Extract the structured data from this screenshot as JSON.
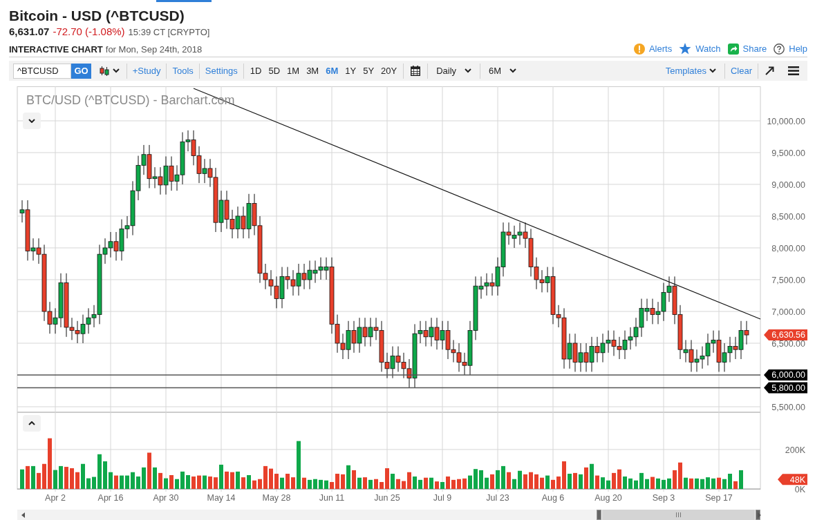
{
  "title": "Bitcoin - USD (^BTCUSD)",
  "quote": {
    "last": "6,631.07",
    "change": "-72.70 (-1.08%)",
    "negative": true,
    "time": "15:39 CT [CRYPTO]"
  },
  "subtitle": {
    "label": "INTERACTIVE CHART",
    "date": "for Mon, Sep 24th, 2018"
  },
  "actions": [
    {
      "kind": "alert",
      "label": "Alerts"
    },
    {
      "kind": "watch",
      "label": "Watch"
    },
    {
      "kind": "share",
      "label": "Share"
    },
    {
      "kind": "help",
      "label": "Help"
    }
  ],
  "toolbar": {
    "symbol": "^BTCUSD",
    "go": "GO",
    "tools": [
      "+Study",
      "Tools",
      "Settings"
    ],
    "ranges": [
      {
        "label": "1D",
        "selected": false
      },
      {
        "label": "5D",
        "selected": false
      },
      {
        "label": "1M",
        "selected": false
      },
      {
        "label": "3M",
        "selected": false
      },
      {
        "label": "6M",
        "selected": true
      },
      {
        "label": "1Y",
        "selected": false
      },
      {
        "label": "5Y",
        "selected": false
      },
      {
        "label": "20Y",
        "selected": false
      }
    ],
    "interval": "Daily",
    "period": "6M",
    "templates": "Templates",
    "clear": "Clear"
  },
  "chart": {
    "title": "BTC/USD (^BTCUSD) - Barchart.com",
    "price_pane": {
      "last_price": "6,630.56",
      "chart_data": {
        "type": "candlestick",
        "ylim": [
          5413,
          10543
        ],
        "categories": [
          null,
          null,
          null,
          null,
          null,
          null,
          null,
          null,
          null,
          null,
          null,
          null,
          null,
          null,
          null,
          null,
          null,
          null,
          null,
          null,
          null,
          null,
          null,
          null,
          null,
          null,
          null,
          null,
          null,
          null,
          null,
          null,
          null,
          null,
          null,
          null,
          null,
          null,
          null,
          null,
          null,
          null,
          null,
          null,
          null,
          null,
          null,
          null,
          null,
          null,
          null,
          null,
          null,
          null,
          null,
          null,
          null,
          null,
          null,
          null,
          null,
          null,
          null,
          null,
          null,
          null,
          null,
          null,
          null,
          null,
          null,
          null,
          null,
          null,
          null,
          null,
          null,
          null,
          null,
          null,
          null,
          null,
          null,
          null,
          null,
          null,
          null,
          null,
          null,
          null,
          null,
          null,
          null,
          null,
          null,
          null,
          null,
          null,
          null,
          null,
          null,
          null,
          null,
          null,
          null,
          null,
          null,
          null,
          null,
          null,
          null,
          null,
          null,
          null,
          null,
          null,
          null,
          null,
          null,
          null,
          null,
          null,
          null,
          null,
          null,
          null,
          null,
          null,
          null,
          null,
          null,
          null
        ],
        "grid": true,
        "ohlc": [
          [
            8550,
            8750,
            8400,
            8600
          ],
          [
            8600,
            8750,
            7800,
            7950
          ],
          [
            7950,
            8150,
            7800,
            8000
          ],
          [
            8000,
            8150,
            7750,
            7900
          ],
          [
            7900,
            8050,
            6850,
            7000
          ],
          [
            7000,
            7150,
            6650,
            6800
          ],
          [
            6800,
            7050,
            6650,
            6900
          ],
          [
            6900,
            7600,
            6750,
            7450
          ],
          [
            7450,
            7600,
            6600,
            6750
          ],
          [
            6750,
            6900,
            6550,
            6700
          ],
          [
            6700,
            6850,
            6500,
            6650
          ],
          [
            6650,
            6950,
            6500,
            6800
          ],
          [
            6800,
            7050,
            6650,
            6900
          ],
          [
            6900,
            7100,
            6750,
            6950
          ],
          [
            6950,
            8050,
            6800,
            7900
          ],
          [
            7900,
            8150,
            7750,
            8000
          ],
          [
            8000,
            8250,
            7850,
            8100
          ],
          [
            8100,
            8250,
            7800,
            7950
          ],
          [
            7950,
            8450,
            7800,
            8300
          ],
          [
            8300,
            8500,
            8150,
            8350
          ],
          [
            8350,
            9050,
            8200,
            8900
          ],
          [
            8900,
            9450,
            8750,
            9300
          ],
          [
            9300,
            9620,
            9150,
            9470
          ],
          [
            9470,
            9620,
            8940,
            9090
          ],
          [
            9090,
            9270,
            8940,
            9120
          ],
          [
            9120,
            9270,
            8840,
            8990
          ],
          [
            8990,
            9440,
            8840,
            9290
          ],
          [
            9290,
            9440,
            8900,
            9050
          ],
          [
            9050,
            9300,
            8900,
            9150
          ],
          [
            9150,
            9820,
            9000,
            9670
          ],
          [
            9670,
            9850,
            9520,
            9700
          ],
          [
            9700,
            9850,
            9300,
            9450
          ],
          [
            9450,
            9600,
            9020,
            9170
          ],
          [
            9170,
            9400,
            9020,
            9250
          ],
          [
            9250,
            9400,
            8960,
            9110
          ],
          [
            9110,
            9260,
            8250,
            8400
          ],
          [
            8400,
            8900,
            8250,
            8750
          ],
          [
            8750,
            8900,
            8300,
            8450
          ],
          [
            8450,
            8600,
            8150,
            8300
          ],
          [
            8300,
            8650,
            8150,
            8500
          ],
          [
            8500,
            8650,
            8150,
            8300
          ],
          [
            8300,
            8850,
            8150,
            8700
          ],
          [
            8700,
            8850,
            8200,
            8350
          ],
          [
            8350,
            8500,
            7450,
            7600
          ],
          [
            7600,
            7750,
            7350,
            7500
          ],
          [
            7500,
            7650,
            7250,
            7400
          ],
          [
            7400,
            7550,
            7050,
            7200
          ],
          [
            7200,
            7700,
            7050,
            7550
          ],
          [
            7550,
            7700,
            7350,
            7500
          ],
          [
            7500,
            7650,
            7250,
            7400
          ],
          [
            7400,
            7750,
            7250,
            7600
          ],
          [
            7600,
            7750,
            7350,
            7500
          ],
          [
            7500,
            7800,
            7350,
            7650
          ],
          [
            7600,
            7800,
            7450,
            7650
          ],
          [
            7650,
            7850,
            7500,
            7700
          ],
          [
            7650,
            7850,
            7500,
            7700
          ],
          [
            7700,
            7850,
            6650,
            6800
          ],
          [
            6800,
            6950,
            6350,
            6500
          ],
          [
            6500,
            6650,
            6250,
            6400
          ],
          [
            6400,
            6850,
            6250,
            6700
          ],
          [
            6700,
            6850,
            6350,
            6500
          ],
          [
            6500,
            6900,
            6350,
            6750
          ],
          [
            6750,
            6900,
            6450,
            6600
          ],
          [
            6600,
            6900,
            6450,
            6750
          ],
          [
            6750,
            6900,
            6550,
            6700
          ],
          [
            6700,
            6850,
            6050,
            6200
          ],
          [
            6200,
            6350,
            5950,
            6100
          ],
          [
            6100,
            6450,
            5950,
            6300
          ],
          [
            6300,
            6450,
            6050,
            6200
          ],
          [
            6200,
            6350,
            5950,
            6100
          ],
          [
            6100,
            6250,
            5800,
            5950
          ],
          [
            5950,
            6800,
            5800,
            6650
          ],
          [
            6650,
            6850,
            6500,
            6700
          ],
          [
            6700,
            6850,
            6450,
            6600
          ],
          [
            6600,
            6900,
            6450,
            6750
          ],
          [
            6750,
            6900,
            6400,
            6550
          ],
          [
            6550,
            6850,
            6400,
            6700
          ],
          [
            6700,
            6850,
            6250,
            6400
          ],
          [
            6400,
            6550,
            6200,
            6350
          ],
          [
            6350,
            6500,
            6050,
            6200
          ],
          [
            6200,
            6350,
            6000,
            6150
          ],
          [
            6150,
            6850,
            6000,
            6700
          ],
          [
            6700,
            7550,
            6550,
            7400
          ],
          [
            7350,
            7550,
            7200,
            7400
          ],
          [
            7400,
            7600,
            7250,
            7450
          ],
          [
            7450,
            7600,
            7250,
            7400
          ],
          [
            7400,
            7850,
            7250,
            7700
          ],
          [
            7700,
            8400,
            7550,
            8250
          ],
          [
            8250,
            8400,
            8050,
            8200
          ],
          [
            8150,
            8350,
            8000,
            8200
          ],
          [
            8200,
            8400,
            8050,
            8250
          ],
          [
            8250,
            8400,
            8000,
            8150
          ],
          [
            8150,
            8300,
            7550,
            7700
          ],
          [
            7700,
            7850,
            7350,
            7500
          ],
          [
            7500,
            7650,
            7300,
            7450
          ],
          [
            7450,
            7700,
            7300,
            7550
          ],
          [
            7550,
            7700,
            6800,
            6950
          ],
          [
            6950,
            7100,
            6750,
            6900
          ],
          [
            6900,
            7050,
            6100,
            6250
          ],
          [
            6250,
            6650,
            6100,
            6500
          ],
          [
            6500,
            6650,
            6050,
            6200
          ],
          [
            6200,
            6500,
            6050,
            6350
          ],
          [
            6350,
            6500,
            6050,
            6200
          ],
          [
            6200,
            6600,
            6050,
            6450
          ],
          [
            6450,
            6600,
            6200,
            6350
          ],
          [
            6350,
            6650,
            6200,
            6500
          ],
          [
            6500,
            6700,
            6350,
            6550
          ],
          [
            6550,
            6700,
            6300,
            6450
          ],
          [
            6450,
            6600,
            6250,
            6400
          ],
          [
            6400,
            6700,
            6250,
            6550
          ],
          [
            6550,
            6750,
            6400,
            6600
          ],
          [
            6600,
            6900,
            6450,
            6750
          ],
          [
            6750,
            7200,
            6600,
            7050
          ],
          [
            7000,
            7200,
            6850,
            7050
          ],
          [
            7050,
            7200,
            6800,
            6950
          ],
          [
            6950,
            7150,
            6800,
            7000
          ],
          [
            7000,
            7450,
            6850,
            7300
          ],
          [
            7300,
            7550,
            7150,
            7400
          ],
          [
            7400,
            7550,
            6800,
            6950
          ],
          [
            6950,
            7100,
            6250,
            6400
          ],
          [
            6350,
            6550,
            6200,
            6400
          ],
          [
            6400,
            6550,
            6050,
            6200
          ],
          [
            6200,
            6400,
            6050,
            6250
          ],
          [
            6250,
            6450,
            6100,
            6300
          ],
          [
            6300,
            6650,
            6150,
            6500
          ],
          [
            6500,
            6700,
            6350,
            6550
          ],
          [
            6550,
            6700,
            6050,
            6200
          ],
          [
            6200,
            6500,
            6050,
            6350
          ],
          [
            6350,
            6600,
            6200,
            6450
          ],
          [
            6450,
            6600,
            6250,
            6400
          ],
          [
            6400,
            6850,
            6250,
            6700
          ],
          [
            6700,
            6850,
            6480,
            6630
          ]
        ],
        "yticks": [
          {
            "value": 5500,
            "label": "5,500.00"
          },
          {
            "value": 6500,
            "label": "6,500.00"
          },
          {
            "value": 7000,
            "label": "7,000.00"
          },
          {
            "value": 7500,
            "label": "7,500.00"
          },
          {
            "value": 8000,
            "label": "8,000.00"
          },
          {
            "value": 8500,
            "label": "8,500.00"
          },
          {
            "value": 9000,
            "label": "9,000.00"
          },
          {
            "value": 9500,
            "label": "9,500.00"
          },
          {
            "value": 10000,
            "label": "10,000.00"
          }
        ],
        "ref_lines": [
          {
            "axis": "y",
            "value": 6000,
            "label": "6,000.00",
            "color": "#555555"
          },
          {
            "axis": "y",
            "value": 5800,
            "label": "5,800.00",
            "color": "#555555"
          }
        ]
      }
    },
    "volume_pane": {
      "last_volume": "48K",
      "chart_data": {
        "type": "bar",
        "ylim": [
          0,
          389
        ],
        "categories": [
          null,
          null,
          null,
          null,
          null,
          null,
          "Apr 2",
          null,
          null,
          null,
          null,
          null,
          null,
          null,
          null,
          null,
          "Apr 16",
          null,
          null,
          null,
          null,
          null,
          null,
          null,
          null,
          null,
          "Apr 30",
          null,
          null,
          null,
          null,
          null,
          null,
          null,
          null,
          null,
          "May 14",
          null,
          null,
          null,
          null,
          null,
          null,
          null,
          null,
          null,
          "May 28",
          null,
          null,
          null,
          null,
          null,
          null,
          null,
          null,
          null,
          "Jun 11",
          null,
          null,
          null,
          null,
          null,
          null,
          null,
          null,
          null,
          "Jun 25",
          null,
          null,
          null,
          null,
          null,
          null,
          null,
          null,
          null,
          "Jul 9",
          null,
          null,
          null,
          null,
          null,
          null,
          null,
          null,
          null,
          "Jul 23",
          null,
          null,
          null,
          null,
          null,
          null,
          null,
          null,
          null,
          "Aug 6",
          null,
          null,
          null,
          null,
          null,
          null,
          null,
          null,
          null,
          "Aug 20",
          null,
          null,
          null,
          null,
          null,
          null,
          null,
          null,
          null,
          "Sep 3",
          null,
          null,
          null,
          null,
          null,
          null,
          null,
          null,
          null,
          "Sep 17",
          null,
          null,
          null,
          null,
          null
        ],
        "values": [
          99,
          116,
          116,
          81,
          127,
          257,
          96,
          116,
          112,
          105,
          85,
          127,
          54,
          61,
          176,
          140,
          85,
          68,
          68,
          68,
          85,
          63,
          109,
          184,
          109,
          81,
          54,
          70,
          50,
          88,
          70,
          63,
          68,
          68,
          63,
          59,
          123,
          88,
          85,
          88,
          59,
          70,
          43,
          50,
          116,
          103,
          77,
          57,
          77,
          59,
          243,
          57,
          46,
          50,
          46,
          43,
          35,
          77,
          74,
          120,
          95,
          57,
          59,
          46,
          50,
          35,
          105,
          77,
          50,
          40,
          85,
          63,
          46,
          57,
          57,
          38,
          35,
          63,
          46,
          50,
          53,
          68,
          101,
          95,
          57,
          74,
          95,
          116,
          85,
          50,
          92,
          74,
          85,
          74,
          57,
          68,
          46,
          63,
          140,
          77,
          81,
          74,
          109,
          127,
          68,
          59,
          43,
          81,
          99,
          63,
          53,
          43,
          81,
          50,
          61,
          53,
          46,
          53,
          95,
          134,
          57,
          53,
          53,
          50,
          59,
          53,
          57,
          50,
          77,
          39,
          95,
          null
        ],
        "yticks": [
          {
            "value": 0,
            "label": "0K"
          },
          {
            "value": 200,
            "label": "200K"
          }
        ]
      }
    }
  }
}
